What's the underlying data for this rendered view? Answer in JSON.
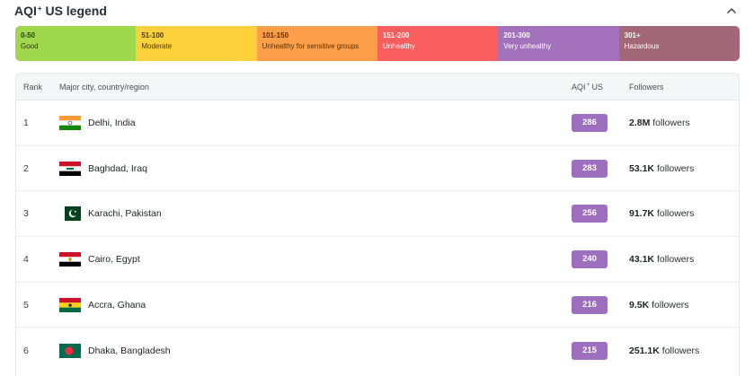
{
  "legend": {
    "title": "AQI",
    "title_sup": "+",
    "title_suffix": " US legend",
    "segments": [
      {
        "range": "0-50",
        "desc": "Good",
        "bg": "#a0d84d",
        "fg": "#2a3a10"
      },
      {
        "range": "51-100",
        "desc": "Moderate",
        "bg": "#fcd13b",
        "fg": "#4a3a00"
      },
      {
        "range": "101-150",
        "desc": "Unhealthy for sensitive groups",
        "bg": "#fd9f4a",
        "fg": "#5a2c00"
      },
      {
        "range": "151-200",
        "desc": "Unhealthy",
        "bg": "#fa5e5f",
        "fg": "#ffffff"
      },
      {
        "range": "201-300",
        "desc": "Very unhealthy",
        "bg": "#a471bd",
        "fg": "#ffffff"
      },
      {
        "range": "301+",
        "desc": "Hazardous",
        "bg": "#a26877",
        "fg": "#ffffff"
      }
    ]
  },
  "table": {
    "headers": {
      "rank": "Rank",
      "city": "Major city, country/region",
      "aqi": "AQI",
      "aqi_sup": "+",
      "aqi_suffix": " US",
      "followers": "Followers"
    },
    "rows": [
      {
        "rank": "1",
        "city": "Delhi, India",
        "flag": "india-flag-icon",
        "aqi": "286",
        "followers_num": "2.8M",
        "followers_word": " followers"
      },
      {
        "rank": "2",
        "city": "Baghdad, Iraq",
        "flag": "iraq-flag-icon",
        "aqi": "283",
        "followers_num": "53.1K",
        "followers_word": " followers"
      },
      {
        "rank": "3",
        "city": "Karachi, Pakistan",
        "flag": "pakistan-flag-icon",
        "aqi": "256",
        "followers_num": "91.7K",
        "followers_word": " followers"
      },
      {
        "rank": "4",
        "city": "Cairo, Egypt",
        "flag": "egypt-flag-icon",
        "aqi": "240",
        "followers_num": "43.1K",
        "followers_word": " followers"
      },
      {
        "rank": "5",
        "city": "Accra, Ghana",
        "flag": "ghana-flag-icon",
        "aqi": "216",
        "followers_num": "9.5K",
        "followers_word": " followers"
      },
      {
        "rank": "6",
        "city": "Dhaka, Bangladesh",
        "flag": "bangladesh-flag-icon",
        "aqi": "215",
        "followers_num": "251.1K",
        "followers_word": " followers"
      }
    ]
  },
  "colors": {
    "aqi_badge": "#9f6fbf"
  }
}
